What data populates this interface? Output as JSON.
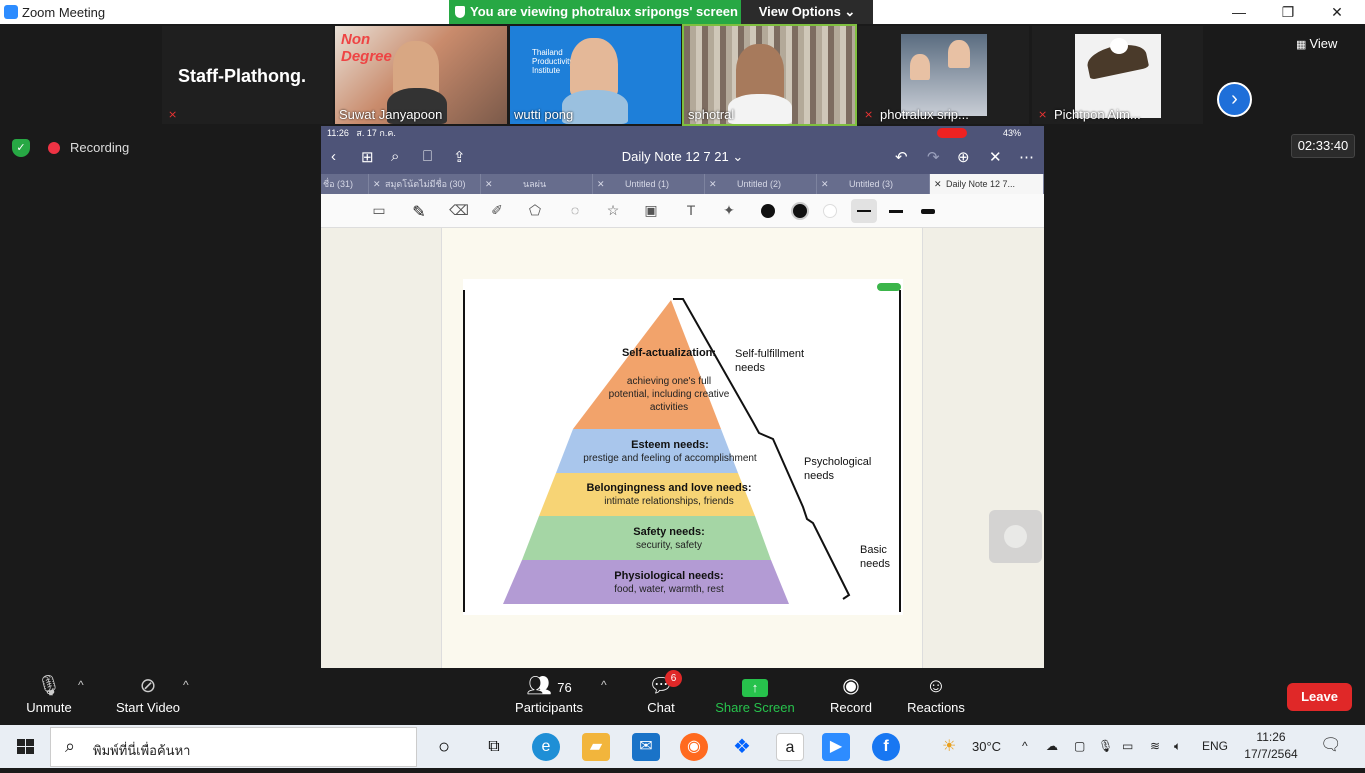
{
  "window": {
    "title": "Zoom Meeting",
    "minimize": "—",
    "maximize": "❐",
    "close": "✕"
  },
  "banner": {
    "viewing_text": "You are viewing photralux sripongs' screen",
    "view_options": "View Options ⌄"
  },
  "strip": {
    "view_label": "View",
    "participants": [
      {
        "name": "Staff-Plathong.",
        "muted": true
      },
      {
        "name": "Suwat Janyapoon",
        "muted": false
      },
      {
        "name": "wutti pong",
        "muted": false
      },
      {
        "name": "sphotral",
        "muted": false
      },
      {
        "name": "photralux srip...",
        "muted": true
      },
      {
        "name": "Pichtpon Aim...",
        "muted": true
      }
    ]
  },
  "status": {
    "recording": "Recording",
    "timer": "02:33:40"
  },
  "ipad": {
    "time": "11:26",
    "date": "ส. 17 ก.ค.",
    "battery": "43%",
    "doc_title": "Daily Note 12 7 21 ⌄",
    "tabs": [
      "ชื่อ (31)",
      "สมุดโน้ตไม่มีชื่อ (30)",
      "นลผ่น",
      "Untitled (1)",
      "Untitled (2)",
      "Untitled (3)",
      "Daily Note 12 7..."
    ]
  },
  "pyramid": {
    "levels": [
      {
        "title": "Self-actualization:",
        "subtitle": "achieving one's full potential, including creative activities",
        "color": "#f2a36b"
      },
      {
        "title": "Esteem needs:",
        "subtitle": "prestige and feeling of accomplishment",
        "color": "#a9c6ec"
      },
      {
        "title": "Belongingness and love needs:",
        "subtitle": "intimate relationships, friends",
        "color": "#f7d475"
      },
      {
        "title": "Safety needs:",
        "subtitle": "security, safety",
        "color": "#a5d6a5"
      },
      {
        "title": "Physiological needs:",
        "subtitle": "food, water, warmth, rest",
        "color": "#b39bd4"
      }
    ],
    "groups": [
      {
        "label1": "Self-fulfillment",
        "label2": "needs"
      },
      {
        "label1": "Psychological",
        "label2": "needs"
      },
      {
        "label1": "Basic",
        "label2": "needs"
      }
    ]
  },
  "controls": {
    "unmute": "Unmute",
    "start_video": "Start Video",
    "participants": "Participants",
    "participants_count": "76",
    "chat": "Chat",
    "chat_badge": "6",
    "share_screen": "Share Screen",
    "record": "Record",
    "reactions": "Reactions",
    "leave": "Leave"
  },
  "taskbar": {
    "search_placeholder": "พิมพ์ที่นี่เพื่อค้นหา",
    "temperature": "30°C",
    "language": "ENG",
    "time": "11:26",
    "date": "17/7/2564"
  }
}
